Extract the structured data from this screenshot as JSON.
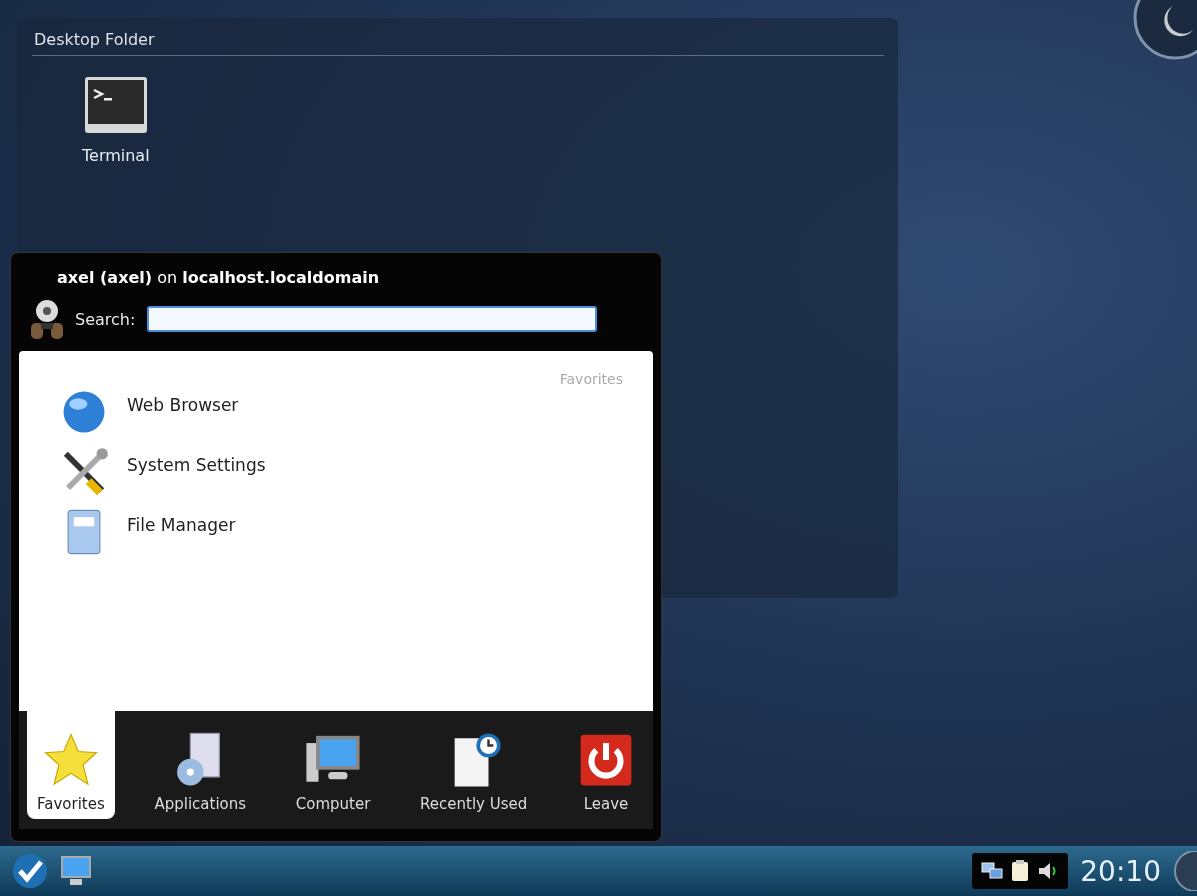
{
  "desktop_folder": {
    "title": "Desktop Folder",
    "items": [
      {
        "label": "Terminal"
      }
    ]
  },
  "launcher": {
    "header": "**axel (axel)** on **localhost.localdomain**",
    "search": {
      "label": "Search:"
    },
    "section_title": "Favorites",
    "favorites": [
      {
        "label": "Web Browser"
      },
      {
        "label": "System Settings"
      },
      {
        "label": "File Manager"
      }
    ],
    "tabs": [
      {
        "label": "Favorites",
        "selected": true
      },
      {
        "label": "Applications",
        "selected": false
      },
      {
        "label": "Computer",
        "selected": false
      },
      {
        "label": "Recently Used",
        "selected": false
      },
      {
        "label": "Leave",
        "selected": false
      }
    ]
  },
  "taskbar": {
    "clock": "20:10"
  }
}
